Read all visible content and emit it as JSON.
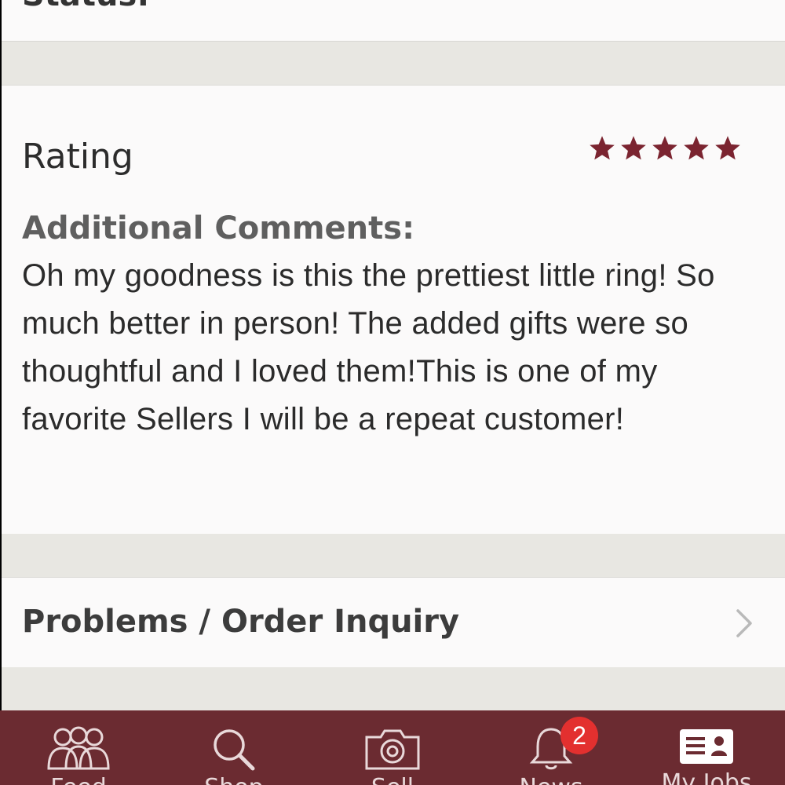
{
  "status_section": {
    "label": "Status:"
  },
  "rating_section": {
    "title": "Rating",
    "stars": 5,
    "star_color": "#7b2430"
  },
  "comments_section": {
    "label": "Additional Comments:",
    "text": "Oh my goodness is this the prettiest little ring! So much better in person! The added gifts were so thoughtful and I loved them!This is one of my favorite Sellers I will be a repeat customer!"
  },
  "problems_section": {
    "label": "Problems / Order Inquiry",
    "icon": "chevron-right-icon"
  },
  "tabbar": {
    "background": "#6b2b31",
    "tabs": [
      {
        "label": "Feed",
        "icon": "people-icon"
      },
      {
        "label": "Shop",
        "icon": "search-icon"
      },
      {
        "label": "Sell",
        "icon": "camera-icon"
      },
      {
        "label": "News",
        "icon": "bell-icon",
        "badge": "2"
      },
      {
        "label": "My Jobs",
        "icon": "profile-card-icon"
      }
    ]
  }
}
